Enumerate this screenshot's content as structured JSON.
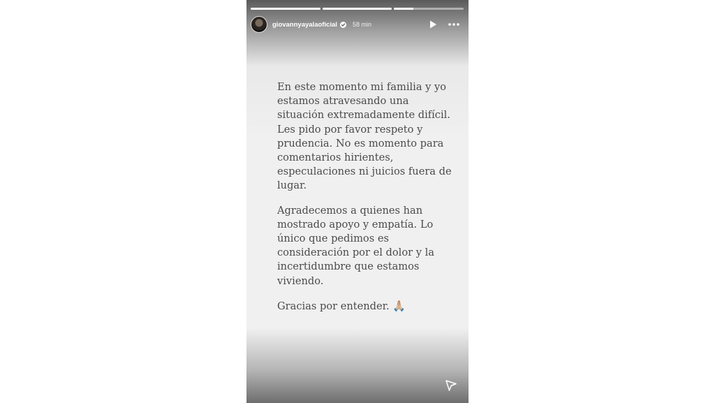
{
  "story": {
    "progress": [
      1,
      1,
      0.28
    ],
    "username": "giovannyayalaoficial",
    "time": "58 min",
    "paragraphs": [
      "En este momento mi familia y yo estamos atravesando una situación extremadamente difícil. Les pido por favor respeto y prudencia. No es momento para comentarios hirientes, especulaciones ni juicios fuera de lugar.",
      "Agradecemos a quienes han mostrado apoyo y empatía. Lo único que pedimos es consideración por el dolor y la incertidumbre que estamos viviendo.",
      "Gracias por entender."
    ],
    "closing_emoji": "🙏🏼"
  },
  "icons": {
    "avatar": "avatar",
    "verified": "verified-badge-icon",
    "play": "play-icon",
    "more": "more-options-icon",
    "send": "send-icon"
  }
}
